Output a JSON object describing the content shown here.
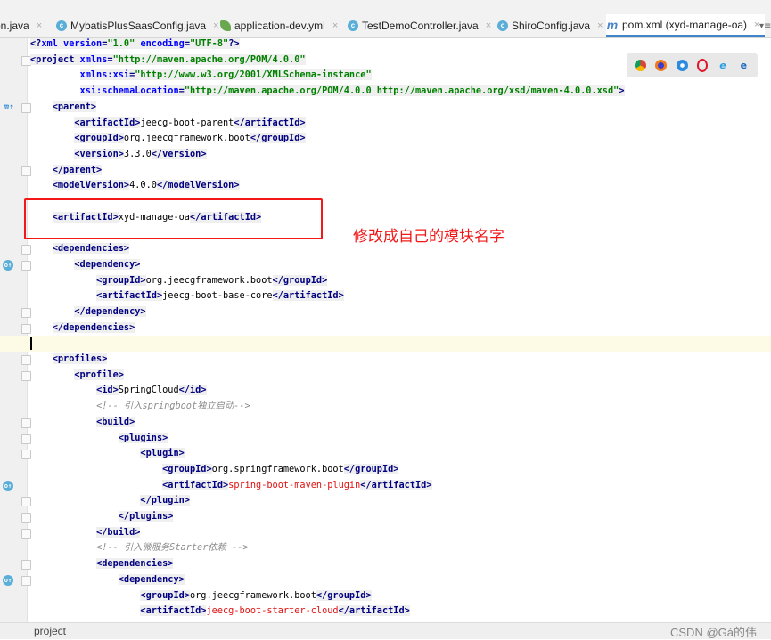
{
  "tabs": [
    {
      "label": "on.java",
      "icon": "java-class-icon",
      "active": false
    },
    {
      "label": "MybatisPlusSaasConfig.java",
      "icon": "java-class-icon",
      "active": false
    },
    {
      "label": "application-dev.yml",
      "icon": "yaml-file-icon",
      "active": false
    },
    {
      "label": "TestDemoController.java",
      "icon": "java-class-icon",
      "active": false
    },
    {
      "label": "ShiroConfig.java",
      "icon": "java-class-icon",
      "active": false
    },
    {
      "label": "pom.xml (xyd-manage-oa)",
      "icon": "maven-icon",
      "active": true
    }
  ],
  "tab_close": "×",
  "tab_menu": "▾≡",
  "browsers": [
    "chrome-icon",
    "firefox-icon",
    "safari-icon",
    "opera-icon",
    "ie-icon",
    "edge-icon"
  ],
  "code_lines": [
    {
      "i": 0,
      "tok": [
        [
          "p",
          "<?"
        ],
        [
          "a",
          "xml "
        ],
        [
          "a",
          "version"
        ],
        [
          "p",
          "="
        ],
        [
          "v",
          "\"1.0\" "
        ],
        [
          "a",
          "encoding"
        ],
        [
          "p",
          "="
        ],
        [
          "v",
          "\"UTF-8\""
        ],
        [
          "p",
          "?>"
        ]
      ]
    },
    {
      "i": 0,
      "fold": true,
      "tok": [
        [
          "t",
          "<project "
        ],
        [
          "a",
          "xmlns"
        ],
        [
          "p",
          "="
        ],
        [
          "v",
          "\"http://maven.apache.org/POM/4.0.0\""
        ]
      ]
    },
    {
      "i": 0,
      "pad": "         ",
      "tok": [
        [
          "a",
          "xmlns:xsi"
        ],
        [
          "p",
          "="
        ],
        [
          "v",
          "\"http://www.w3.org/2001/XMLSchema-instance\""
        ]
      ]
    },
    {
      "i": 0,
      "pad": "         ",
      "tok": [
        [
          "a",
          "xsi:schemaLocation"
        ],
        [
          "p",
          "="
        ],
        [
          "v",
          "\"http://maven.apache.org/POM/4.0.0 http://maven.apache.org/xsd/maven-4.0.0.xsd\""
        ],
        [
          "t",
          ">"
        ]
      ]
    },
    {
      "i": 1,
      "fold": true,
      "gicon": "m",
      "tok": [
        [
          "t",
          "<parent>"
        ]
      ]
    },
    {
      "i": 2,
      "tok": [
        [
          "t",
          "<artifactId>"
        ],
        [
          "x",
          "jeecg-boot-parent"
        ],
        [
          "t",
          "</artifactId>"
        ]
      ]
    },
    {
      "i": 2,
      "tok": [
        [
          "t",
          "<groupId>"
        ],
        [
          "x",
          "org.jeecgframework.boot"
        ],
        [
          "t",
          "</groupId>"
        ]
      ]
    },
    {
      "i": 2,
      "tok": [
        [
          "t",
          "<version>"
        ],
        [
          "x",
          "3.3.0"
        ],
        [
          "t",
          "</version>"
        ]
      ]
    },
    {
      "i": 1,
      "fold": true,
      "tok": [
        [
          "t",
          "</parent>"
        ]
      ]
    },
    {
      "i": 1,
      "tok": [
        [
          "t",
          "<modelVersion>"
        ],
        [
          "x",
          "4.0.0"
        ],
        [
          "t",
          "</modelVersion>"
        ]
      ]
    },
    {
      "i": 0,
      "tok": []
    },
    {
      "i": 1,
      "tok": [
        [
          "t",
          "<artifactId>"
        ],
        [
          "x",
          "xyd-manage-oa"
        ],
        [
          "t",
          "</artifactId>"
        ]
      ]
    },
    {
      "i": 0,
      "tok": []
    },
    {
      "i": 1,
      "fold": true,
      "tok": [
        [
          "t",
          "<dependencies>"
        ]
      ]
    },
    {
      "i": 2,
      "fold": true,
      "gicon": "o",
      "tok": [
        [
          "t",
          "<dependency>"
        ]
      ]
    },
    {
      "i": 3,
      "tok": [
        [
          "t",
          "<groupId>"
        ],
        [
          "x",
          "org.jeecgframework.boot"
        ],
        [
          "t",
          "</groupId>"
        ]
      ]
    },
    {
      "i": 3,
      "tok": [
        [
          "t",
          "<artifactId>"
        ],
        [
          "x",
          "jeecg-boot-base-core"
        ],
        [
          "t",
          "</artifactId>"
        ]
      ]
    },
    {
      "i": 2,
      "fold": true,
      "tok": [
        [
          "t",
          "</dependency>"
        ]
      ]
    },
    {
      "i": 1,
      "fold": true,
      "tok": [
        [
          "t",
          "</dependencies>"
        ]
      ]
    },
    {
      "i": 0,
      "cur": true,
      "tok": []
    },
    {
      "i": 1,
      "fold": true,
      "tok": [
        [
          "t",
          "<profiles>"
        ]
      ]
    },
    {
      "i": 2,
      "fold": true,
      "tok": [
        [
          "t",
          "<profile>"
        ]
      ]
    },
    {
      "i": 3,
      "tok": [
        [
          "t",
          "<id>"
        ],
        [
          "x",
          "SpringCloud"
        ],
        [
          "t",
          "</id>"
        ]
      ]
    },
    {
      "i": 3,
      "tok": [
        [
          "c",
          "<!-- 引入springboot独立启动-->"
        ]
      ]
    },
    {
      "i": 3,
      "fold": true,
      "tok": [
        [
          "t",
          "<build>"
        ]
      ]
    },
    {
      "i": 4,
      "fold": true,
      "tok": [
        [
          "t",
          "<plugins>"
        ]
      ]
    },
    {
      "i": 5,
      "fold": true,
      "tok": [
        [
          "t",
          "<plugin>"
        ]
      ]
    },
    {
      "i": 6,
      "tok": [
        [
          "t",
          "<groupId>"
        ],
        [
          "x",
          "org.springframework.boot"
        ],
        [
          "t",
          "</groupId>"
        ]
      ]
    },
    {
      "i": 6,
      "gicon": "o",
      "tok": [
        [
          "t",
          "<artifactId>"
        ],
        [
          "r",
          "spring-boot-maven-plugin"
        ],
        [
          "t",
          "</artifactId>"
        ]
      ]
    },
    {
      "i": 5,
      "fold": true,
      "tok": [
        [
          "t",
          "</plugin>"
        ]
      ]
    },
    {
      "i": 4,
      "fold": true,
      "tok": [
        [
          "t",
          "</plugins>"
        ]
      ]
    },
    {
      "i": 3,
      "fold": true,
      "tok": [
        [
          "t",
          "</build>"
        ]
      ]
    },
    {
      "i": 3,
      "tok": [
        [
          "c",
          "<!-- 引入微服务Starter依赖 -->"
        ]
      ]
    },
    {
      "i": 3,
      "fold": true,
      "tok": [
        [
          "t",
          "<dependencies>"
        ]
      ]
    },
    {
      "i": 4,
      "fold": true,
      "gicon": "o",
      "tok": [
        [
          "t",
          "<dependency>"
        ]
      ]
    },
    {
      "i": 5,
      "tok": [
        [
          "t",
          "<groupId>"
        ],
        [
          "x",
          "org.jeecgframework.boot"
        ],
        [
          "t",
          "</groupId>"
        ]
      ]
    },
    {
      "i": 5,
      "tok": [
        [
          "t",
          "<artifactId>"
        ],
        [
          "r",
          "jeecg-boot-starter-cloud"
        ],
        [
          "t",
          "</artifactId>"
        ]
      ]
    }
  ],
  "annotation": {
    "text": "修改成自己的模块名字",
    "color": "#f21818"
  },
  "status": {
    "breadcrumb": "project"
  },
  "watermark": "CSDN @Gá的伟"
}
